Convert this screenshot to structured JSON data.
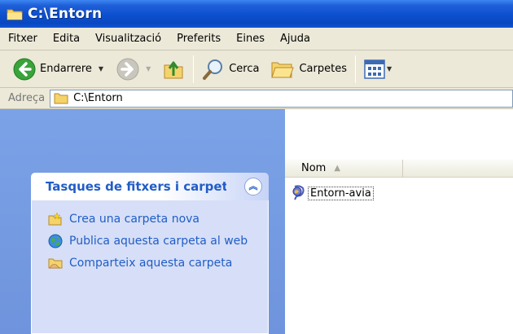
{
  "window": {
    "title": "C:\\Entorn"
  },
  "menu": [
    "Fitxer",
    "Edita",
    "Visualització",
    "Preferits",
    "Eines",
    "Ajuda"
  ],
  "toolbar": {
    "back_label": "Endarrere",
    "search_label": "Cerca",
    "folders_label": "Carpetes"
  },
  "address": {
    "label": "Adreça",
    "value": "C:\\Entorn"
  },
  "tasks": {
    "title": "Tasques de fitxers i carpet",
    "items": [
      {
        "label": "Crea una carpeta nova",
        "icon": "new-folder-icon"
      },
      {
        "label": "Publica aquesta carpeta al web",
        "icon": "publish-web-icon"
      },
      {
        "label": "Comparteix aquesta carpeta",
        "icon": "share-folder-icon"
      }
    ]
  },
  "filelist": {
    "columns": [
      "Nom"
    ],
    "files": [
      {
        "name": "Entorn-avia",
        "icon": "html-file-icon"
      }
    ]
  },
  "colors": {
    "titlebar": "#0c4fcf",
    "sidepane": "#7ba2e7",
    "task_text": "#215dc6",
    "chrome": "#ece9d8"
  }
}
